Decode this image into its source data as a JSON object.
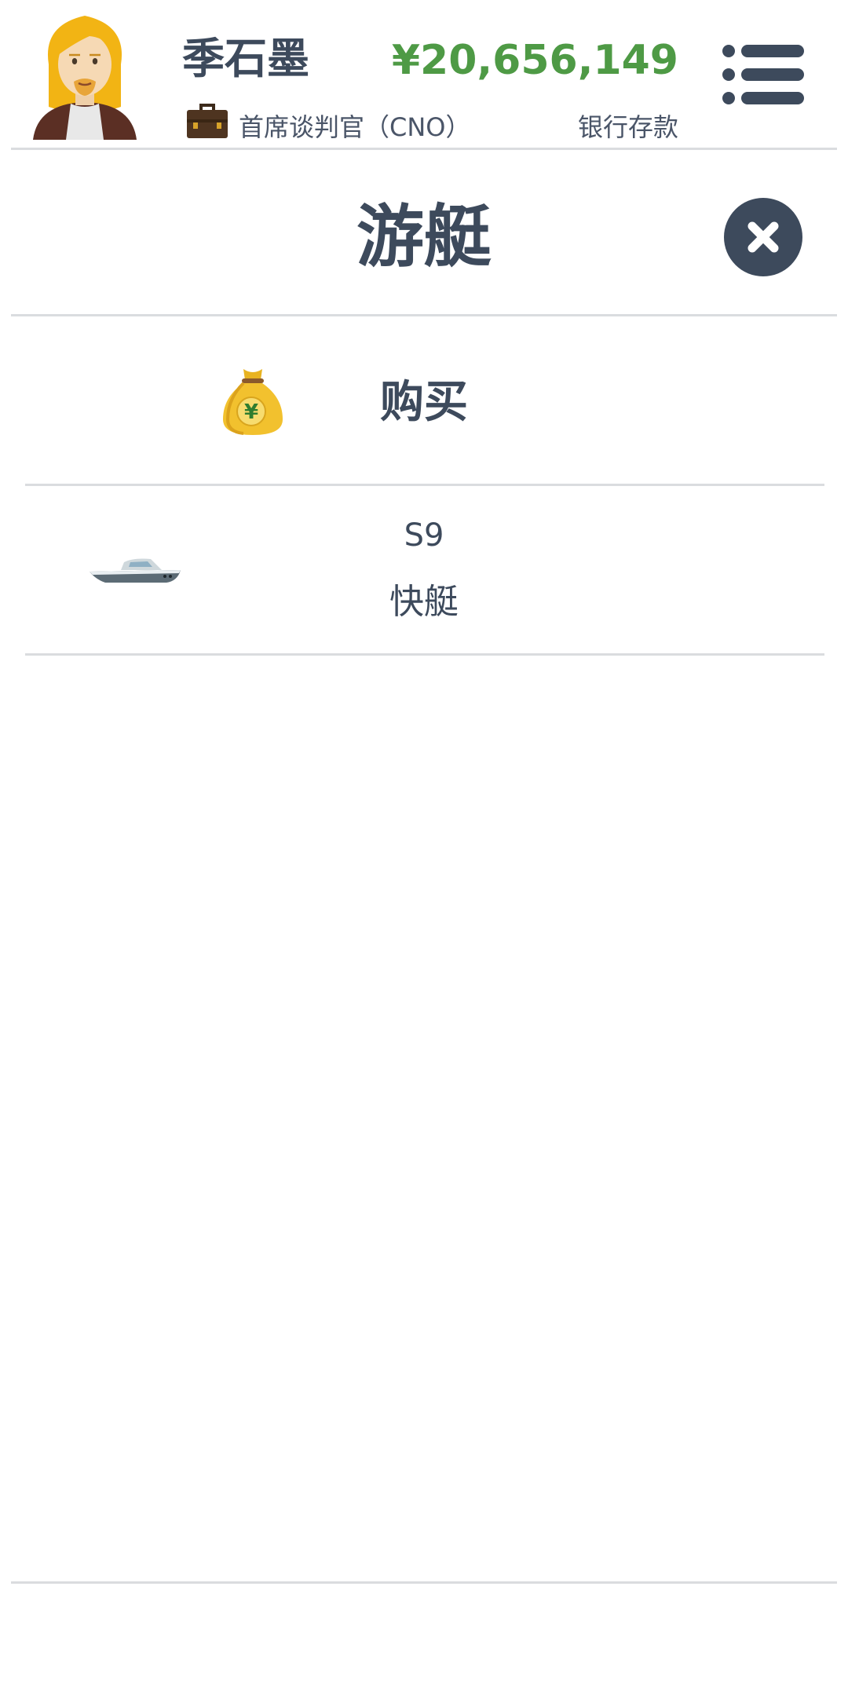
{
  "player": {
    "name": "季石墨",
    "title": "首席谈判官（CNO）",
    "avatar_icon": "blonde-man-avatar-icon"
  },
  "bank": {
    "balance": "¥20,656,149",
    "label": "银行存款",
    "balance_color": "#4e9a45"
  },
  "header": {
    "menu_icon": "list-menu-icon"
  },
  "page": {
    "title": "游艇",
    "close_icon": "close-icon"
  },
  "actions": {
    "buy_label": "购买",
    "buy_icon": "money-bag-icon"
  },
  "yachts": [
    {
      "model": "S9",
      "type": "快艇",
      "icon": "speedboat-icon"
    }
  ],
  "theme": {
    "primary_text": "#3d4a5c",
    "divider": "#dadcdf",
    "background": "#ffffff"
  }
}
